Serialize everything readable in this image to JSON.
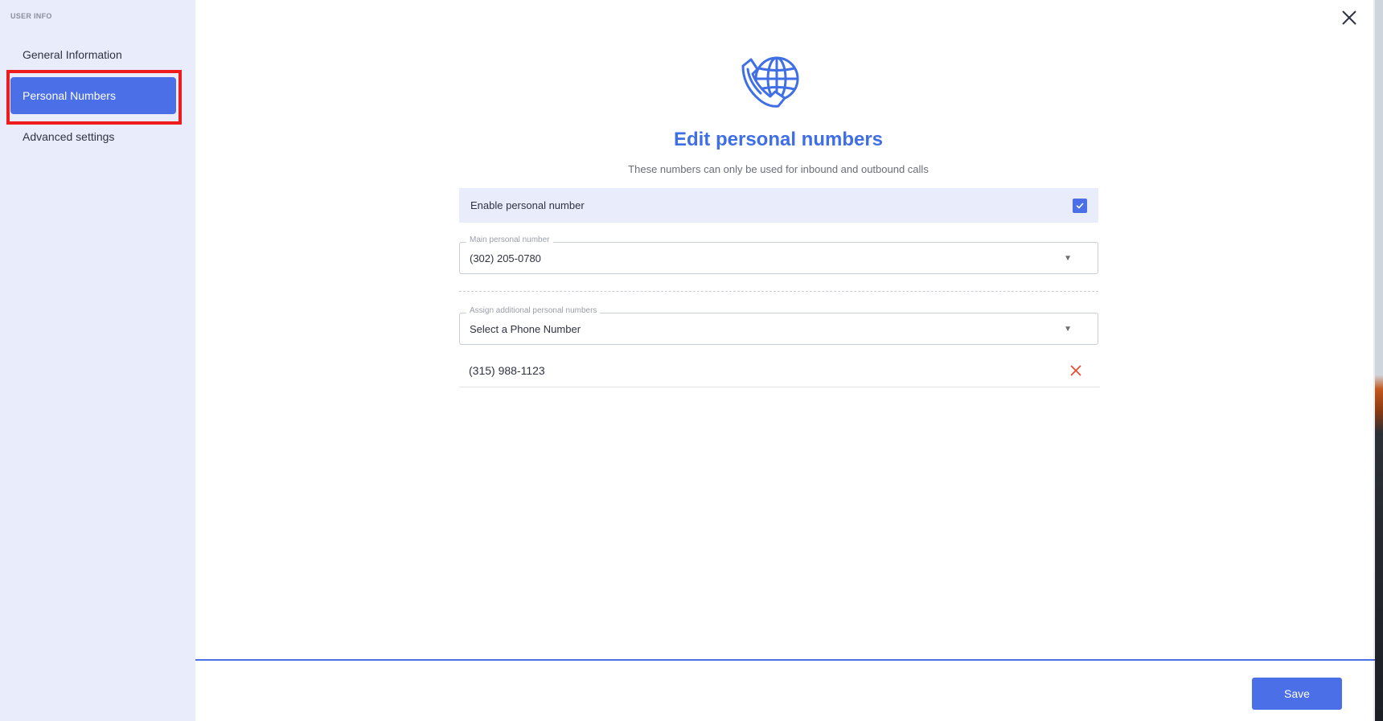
{
  "sidebar": {
    "heading": "USER INFO",
    "items": [
      {
        "label": "General Information",
        "active": false
      },
      {
        "label": "Personal Numbers",
        "active": true
      },
      {
        "label": "Advanced settings",
        "active": false
      }
    ]
  },
  "header": {
    "title": "Edit personal numbers",
    "subtitle": "These numbers can only be used for inbound and outbound calls",
    "icon": "phone-globe-icon"
  },
  "form": {
    "enable_label": "Enable personal number",
    "enable_checked": true,
    "main_number_legend": "Main personal number",
    "main_number_value": "(302) 205-0780",
    "additional_legend": "Assign additional personal numbers",
    "additional_placeholder": "Select a Phone Number",
    "assigned_numbers": [
      "(315) 988-1123"
    ]
  },
  "footer": {
    "save_label": "Save"
  },
  "colors": {
    "accent": "#4a6fe6",
    "title": "#3f6ee5",
    "sidebar_bg": "#e9edfb",
    "highlight": "#ee1c1c",
    "remove": "#e8452c"
  }
}
